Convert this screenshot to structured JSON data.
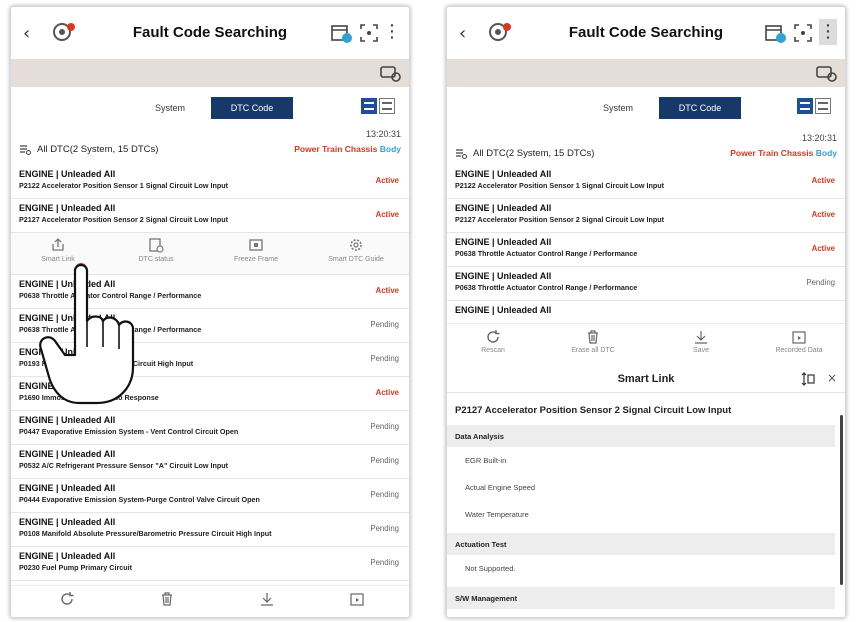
{
  "header": {
    "title": "Fault Code Searching"
  },
  "tabs": {
    "system": "System",
    "dtc_code": "DTC Code"
  },
  "summary": {
    "time": "13:20:31",
    "text": "All DTC(2 System, 15 DTCs)",
    "cat_powertrain": "Power Train",
    "cat_chassis": "Chassis",
    "cat_body": "Body"
  },
  "colors": {
    "navy": "#17386b",
    "active_red": "#d9391f",
    "body_blue": "#2fa3d6",
    "beige": "#e5ded8"
  },
  "left": {
    "dtcs_top": [
      {
        "system": "ENGINE | Unleaded All",
        "desc": "P2122 Accelerator Position Sensor 1 Signal Circuit Low Input",
        "status": "Active"
      },
      {
        "system": "ENGINE | Unleaded All",
        "desc": "P2127 Accelerator Position Sensor 2 Signal Circuit Low Input",
        "status": "Active"
      }
    ],
    "actions": [
      {
        "icon": "share-icon",
        "label": "Smart Link"
      },
      {
        "icon": "dtc-status-icon",
        "label": "DTC status"
      },
      {
        "icon": "freeze-frame-icon",
        "label": "Freeze Frame"
      },
      {
        "icon": "gear-icon",
        "label": "Smart DTC Guide"
      }
    ],
    "dtcs_rest": [
      {
        "system": "ENGINE | Unleaded All",
        "desc": "P0638 Throttle Actuator Control Range / Performance",
        "status": "Active"
      },
      {
        "system": "ENGINE | Unleaded All",
        "desc": "P0638 Throttle Actuator Control Range / Performance",
        "status": "Pending"
      },
      {
        "system": "ENGINE | Unleaded All",
        "desc": "P0193 Fuel Rail Pressure Sensor Circuit High Input",
        "status": "Pending"
      },
      {
        "system": "ENGINE | Unleaded All",
        "desc": "P1690 Immobilizer Smartra No Response",
        "status": "Active"
      },
      {
        "system": "ENGINE | Unleaded All",
        "desc": "P0447 Evaporative Emission System - Vent Control Circuit Open",
        "status": "Pending"
      },
      {
        "system": "ENGINE | Unleaded All",
        "desc": "P0532 A/C Refrigerant Pressure Sensor \"A\" Circuit Low Input",
        "status": "Pending"
      },
      {
        "system": "ENGINE | Unleaded All",
        "desc": "P0444 Evaporative Emission System-Purge Control Valve Circuit Open",
        "status": "Pending"
      },
      {
        "system": "ENGINE | Unleaded All",
        "desc": "P0108 Manifold Absolute Pressure/Barometric Pressure Circuit High Input",
        "status": "Pending"
      },
      {
        "system": "ENGINE | Unleaded All",
        "desc": "P0230 Fuel Pump Primary Circuit",
        "status": "Pending"
      }
    ]
  },
  "right": {
    "dtcs": [
      {
        "system": "ENGINE | Unleaded All",
        "desc": "P2122 Accelerator Position Sensor 1 Signal Circuit Low Input",
        "status": "Active"
      },
      {
        "system": "ENGINE | Unleaded All",
        "desc": "P2127 Accelerator Position Sensor 2 Signal Circuit Low Input",
        "status": "Active"
      },
      {
        "system": "ENGINE | Unleaded All",
        "desc": "P0638 Throttle Actuator Control Range / Performance",
        "status": "Active"
      },
      {
        "system": "ENGINE | Unleaded All",
        "desc": "P0638 Throttle Actuator Control Range / Performance",
        "status": "Pending"
      },
      {
        "system": "ENGINE | Unleaded All",
        "desc": "",
        "status": ""
      }
    ],
    "bottom": [
      {
        "icon": "rescan-icon",
        "label": "Rescan"
      },
      {
        "icon": "trash-icon",
        "label": "Erase all DTC"
      },
      {
        "icon": "save-icon",
        "label": "Save"
      },
      {
        "icon": "recorded-data-icon",
        "label": "Recorded Data"
      }
    ],
    "panel": {
      "title": "Smart Link",
      "dtc_title": "P2127 Accelerator Position Sensor 2 Signal Circuit Low Input",
      "sections": [
        {
          "name": "Data Analysis",
          "items": [
            "EGR Built-in",
            "Actual Engine Speed",
            "Water Temperature"
          ]
        },
        {
          "name": "Actuation Test",
          "items": [
            "Not Supported."
          ]
        },
        {
          "name": "S/W Management",
          "items": []
        }
      ]
    }
  }
}
